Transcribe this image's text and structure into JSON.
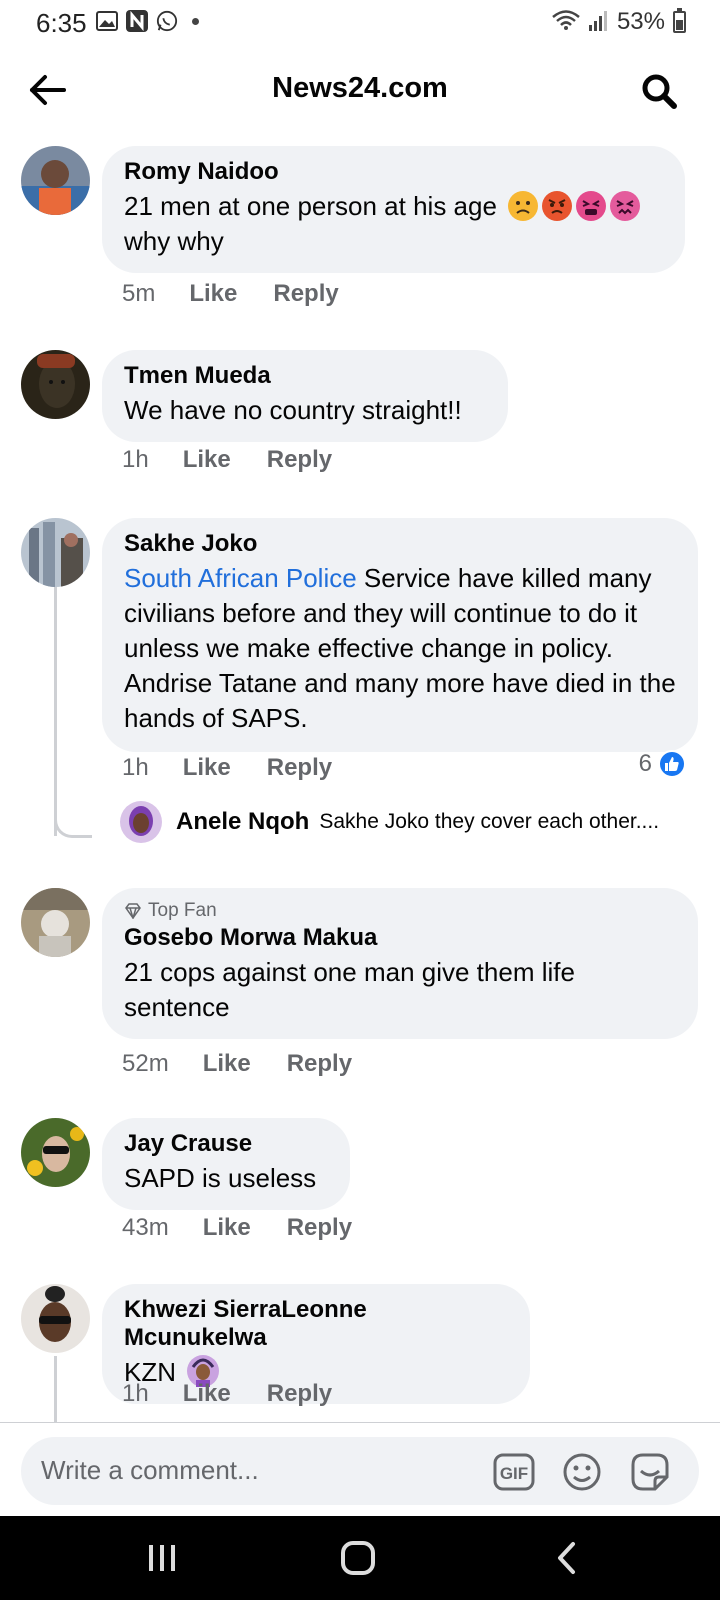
{
  "status_bar": {
    "time": "6:35",
    "battery": "53%",
    "battery_level": 0.53,
    "icons": [
      "image-icon",
      "n-app-icon",
      "whatsapp-icon",
      "dot-icon",
      "wifi-icon",
      "signal-icon",
      "battery-icon"
    ]
  },
  "header": {
    "title": "News24.com",
    "back_icon": "back-arrow-icon",
    "search_icon": "search-icon"
  },
  "comments": [
    {
      "name": "Romy Naidoo",
      "text": "21 men at one person at his age",
      "text_line2": "why why",
      "emojis": [
        "frowning-face",
        "angry-face",
        "tired-face",
        "confounded-face"
      ],
      "time": "5m",
      "like": "Like",
      "reply": "Reply"
    },
    {
      "name": "Tmen Mueda",
      "text": "We have no country straight!!",
      "time": "1h",
      "like": "Like",
      "reply": "Reply"
    },
    {
      "name": "Sakhe Joko",
      "link_text": "South African Police",
      "text": " Service have killed many civilians before and they will continue to do it unless we make effective change in policy. Andrise Tatane and many more have died in the hands of SAPS.",
      "time": "1h",
      "like": "Like",
      "reply": "Reply",
      "reaction_count": "6"
    },
    {
      "badge": "Top Fan",
      "name": "Gosebo Morwa Makua",
      "text": "21 cops against one man give them life sentence",
      "time": "52m",
      "like": "Like",
      "reply": "Reply"
    },
    {
      "name": "Jay Crause",
      "text": "SAPD is useless",
      "time": "43m",
      "like": "Like",
      "reply": "Reply"
    },
    {
      "name": "Khwezi SierraLeonne Mcunukelwa",
      "text": "KZN",
      "emojis": [
        "person-gesturing-ok"
      ],
      "time": "1h",
      "like": "Like",
      "reply": "Reply"
    }
  ],
  "reply_preview": {
    "name": "Anele Nqoh",
    "text": "Sakhe Joko they cover each other...."
  },
  "composer": {
    "placeholder": "Write a comment...",
    "icons": [
      "gif-icon",
      "emoji-icon",
      "sticker-icon"
    ],
    "gif_label": "GIF"
  },
  "navbar": {
    "icons": [
      "recent-apps-icon",
      "home-icon",
      "back-nav-icon"
    ]
  },
  "colors": {
    "bubble": "#f0f2f5",
    "link": "#216fdb",
    "meta": "#65676b",
    "like_blue": "#1877f2"
  }
}
